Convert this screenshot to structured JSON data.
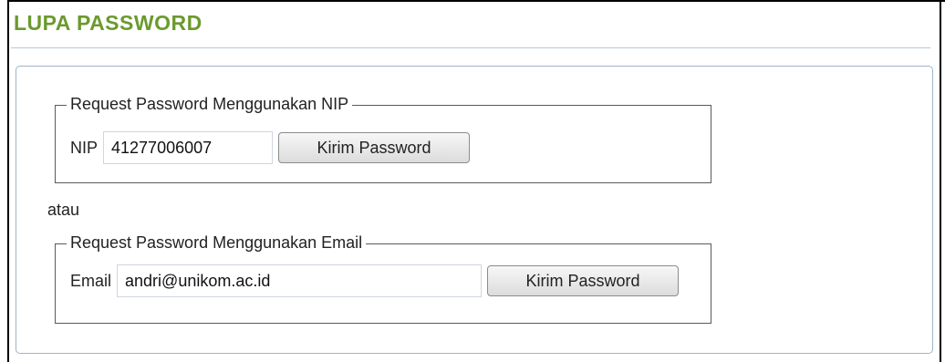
{
  "page": {
    "title": "LUPA PASSWORD"
  },
  "nip_section": {
    "legend": "Request Password Menggunakan NIP",
    "field_label": "NIP",
    "field_value": "41277006007",
    "button_label": "Kirim Password"
  },
  "separator_text": "atau",
  "email_section": {
    "legend": "Request Password Menggunakan Email",
    "field_label": "Email",
    "field_value": "andri@unikom.ac.id",
    "button_label": "Kirim Password"
  },
  "colors": {
    "title": "#6b9a2e",
    "panel_border": "#9fb4ca"
  }
}
